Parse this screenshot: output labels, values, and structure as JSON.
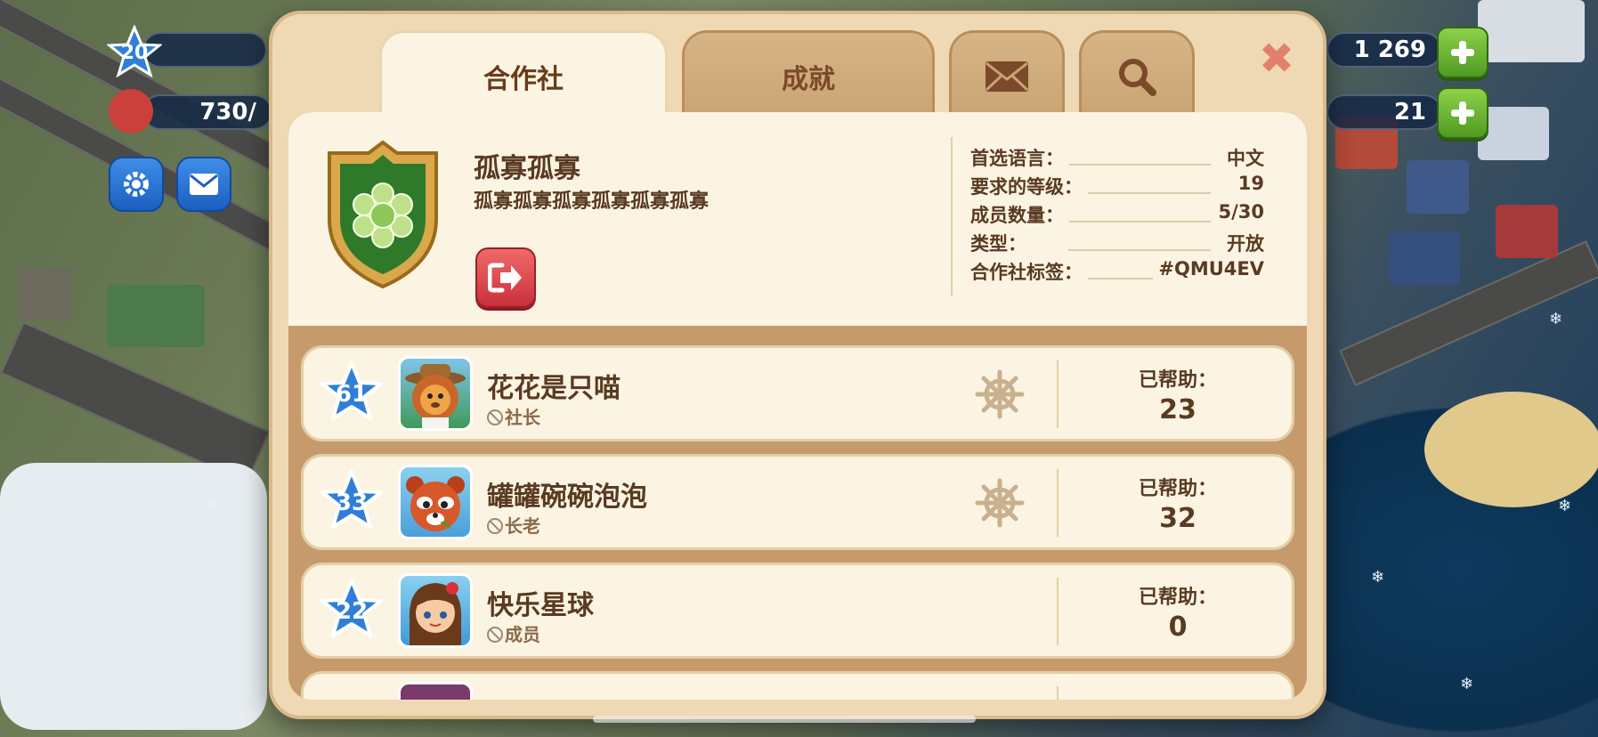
{
  "hud": {
    "level": "20",
    "population": "730/",
    "coins": "1 269",
    "cash": "21"
  },
  "tabs": [
    {
      "label": "合作社",
      "active": true
    },
    {
      "label": "成就",
      "active": false
    },
    {
      "icon": "envelope-icon"
    },
    {
      "icon": "search-icon"
    }
  ],
  "close_label": "✖",
  "coop": {
    "name": "孤寡孤寡",
    "description": "孤寡孤寡孤寡孤寡孤寡孤寡",
    "badge_icon": "flower-shield-icon",
    "stats": [
      {
        "label": "首选语言：",
        "value": "中文"
      },
      {
        "label": "要求的等级：",
        "value": "19"
      },
      {
        "label": "成员数量：",
        "value": "5/30"
      },
      {
        "label": "类型：",
        "value": "开放"
      },
      {
        "label": "合作社标签：",
        "value": "#QMU4EV"
      }
    ]
  },
  "members": [
    {
      "level": "61",
      "name": "花花是只喵",
      "role": "社长",
      "helped_label": "已帮助：",
      "helped": "23",
      "wheel": true,
      "avatar": "lion"
    },
    {
      "level": "33",
      "name": "罐罐碗碗泡泡",
      "role": "长老",
      "helped_label": "已帮助：",
      "helped": "32",
      "wheel": true,
      "avatar": "red-panda"
    },
    {
      "level": "22",
      "name": "快乐星球",
      "role": "成员",
      "helped_label": "已帮助：",
      "helped": "0",
      "wheel": false,
      "avatar": "girl"
    }
  ],
  "colors": {
    "panel": "#efd9b4",
    "card": "#fbf4e2",
    "text": "#5a3a22",
    "leave_button": "#d9404a",
    "level_star": "#2f7fd9"
  }
}
